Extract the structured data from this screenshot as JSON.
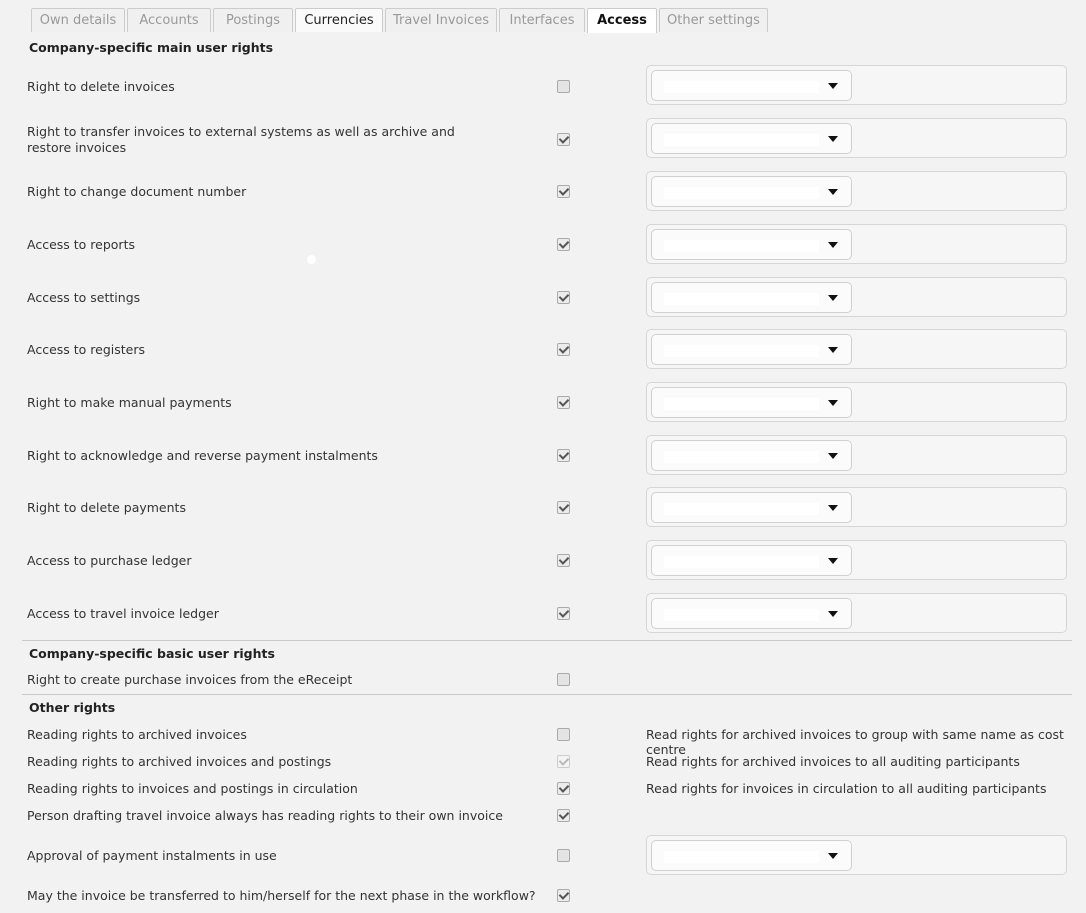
{
  "tabs": [
    {
      "label": "Own details",
      "state": "inactive"
    },
    {
      "label": "Accounts",
      "state": "inactive"
    },
    {
      "label": "Postings",
      "state": "inactive"
    },
    {
      "label": "Currencies",
      "state": "dark"
    },
    {
      "label": "Travel Invoices",
      "state": "inactive"
    },
    {
      "label": "Interfaces",
      "state": "inactive"
    },
    {
      "label": "Access",
      "state": "active"
    },
    {
      "label": "Other settings",
      "state": "inactive"
    }
  ],
  "main_rights": {
    "title": "Company-specific main user rights",
    "rows": [
      {
        "label": "Right to delete invoices",
        "checked": false
      },
      {
        "label": "Right to transfer invoices to external systems as well as archive and restore invoices",
        "checked": true
      },
      {
        "label": "Right to change document number",
        "checked": true
      },
      {
        "label": "Access to reports",
        "checked": true
      },
      {
        "label": "Access to settings",
        "checked": true
      },
      {
        "label": "Access to registers",
        "checked": true
      },
      {
        "label": "Right to make manual payments",
        "checked": true
      },
      {
        "label": "Right to acknowledge and reverse payment instalments",
        "checked": true
      },
      {
        "label": "Right to delete payments",
        "checked": true
      },
      {
        "label": "Access to purchase ledger",
        "checked": true
      },
      {
        "label": "Access to travel invoice ledger",
        "checked": true
      }
    ]
  },
  "basic_rights": {
    "title": "Company-specific basic user rights",
    "rows": [
      {
        "label": "Right to create purchase invoices from the eReceipt",
        "checked": false
      }
    ]
  },
  "other_rights": {
    "title": "Other rights",
    "rows": [
      {
        "label": "Reading rights to archived invoices",
        "checked": false,
        "right": "Read rights for archived invoices to group with same name as cost centre"
      },
      {
        "label": "Reading rights to archived invoices and postings",
        "checked": true,
        "light": true,
        "right": "Read rights for archived invoices to all auditing participants"
      },
      {
        "label": "Reading rights to invoices and postings in circulation",
        "checked": true,
        "right": "Read rights for invoices in circulation to all auditing participants"
      },
      {
        "label": "Person drafting travel invoice always has reading rights to their own invoice",
        "checked": true
      }
    ],
    "approval": {
      "label": "Approval of payment instalments in use",
      "checked": false
    },
    "transfer": {
      "label": "May the invoice be transferred to him/herself for the next phase in the workflow?",
      "checked": true
    }
  }
}
